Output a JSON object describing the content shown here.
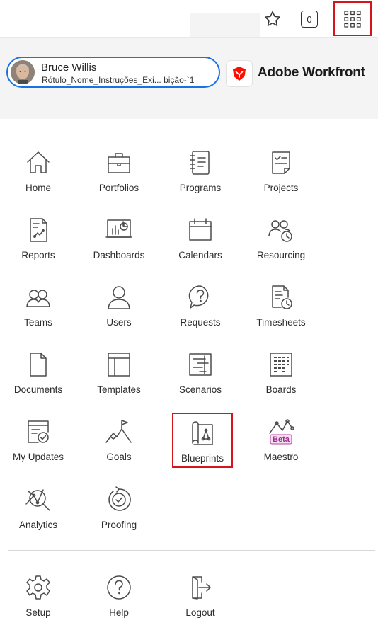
{
  "topbar": {
    "count": "0",
    "icons": [
      "star-icon",
      "grid-icon"
    ]
  },
  "user": {
    "name": "Bruce Willis",
    "subtitle": "Rótulo_Nome_Instruções_Exi... bição-`1"
  },
  "brand": {
    "name": "Adobe Workfront",
    "accent": "#fa0f00",
    "highlight": "#d6141e",
    "focus": "#1473e6"
  },
  "apps": [
    {
      "label": "Home",
      "icon": "home-icon"
    },
    {
      "label": "Portfolios",
      "icon": "briefcase-icon"
    },
    {
      "label": "Programs",
      "icon": "notebook-icon"
    },
    {
      "label": "Projects",
      "icon": "checklist-icon"
    },
    {
      "label": "Reports",
      "icon": "report-icon"
    },
    {
      "label": "Dashboards",
      "icon": "dashboard-icon"
    },
    {
      "label": "Calendars",
      "icon": "calendar-icon"
    },
    {
      "label": "Resourcing",
      "icon": "resourcing-icon"
    },
    {
      "label": "Teams",
      "icon": "team-icon"
    },
    {
      "label": "Users",
      "icon": "user-icon"
    },
    {
      "label": "Requests",
      "icon": "request-icon"
    },
    {
      "label": "Timesheets",
      "icon": "timesheet-icon"
    },
    {
      "label": "Documents",
      "icon": "document-icon"
    },
    {
      "label": "Templates",
      "icon": "template-icon"
    },
    {
      "label": "Scenarios",
      "icon": "scenario-icon"
    },
    {
      "label": "Boards",
      "icon": "board-icon"
    },
    {
      "label": "My Updates",
      "icon": "updates-icon"
    },
    {
      "label": "Goals",
      "icon": "goal-icon"
    },
    {
      "label": "Blueprints",
      "icon": "blueprint-icon"
    },
    {
      "label": "Maestro",
      "icon": "maestro-icon",
      "badge": "Beta"
    },
    {
      "label": "Analytics",
      "icon": "analytics-icon"
    },
    {
      "label": "Proofing",
      "icon": "proofing-icon"
    }
  ],
  "footer": [
    {
      "label": "Setup",
      "icon": "gear-icon"
    },
    {
      "label": "Help",
      "icon": "help-icon"
    },
    {
      "label": "Logout",
      "icon": "logout-icon"
    }
  ]
}
